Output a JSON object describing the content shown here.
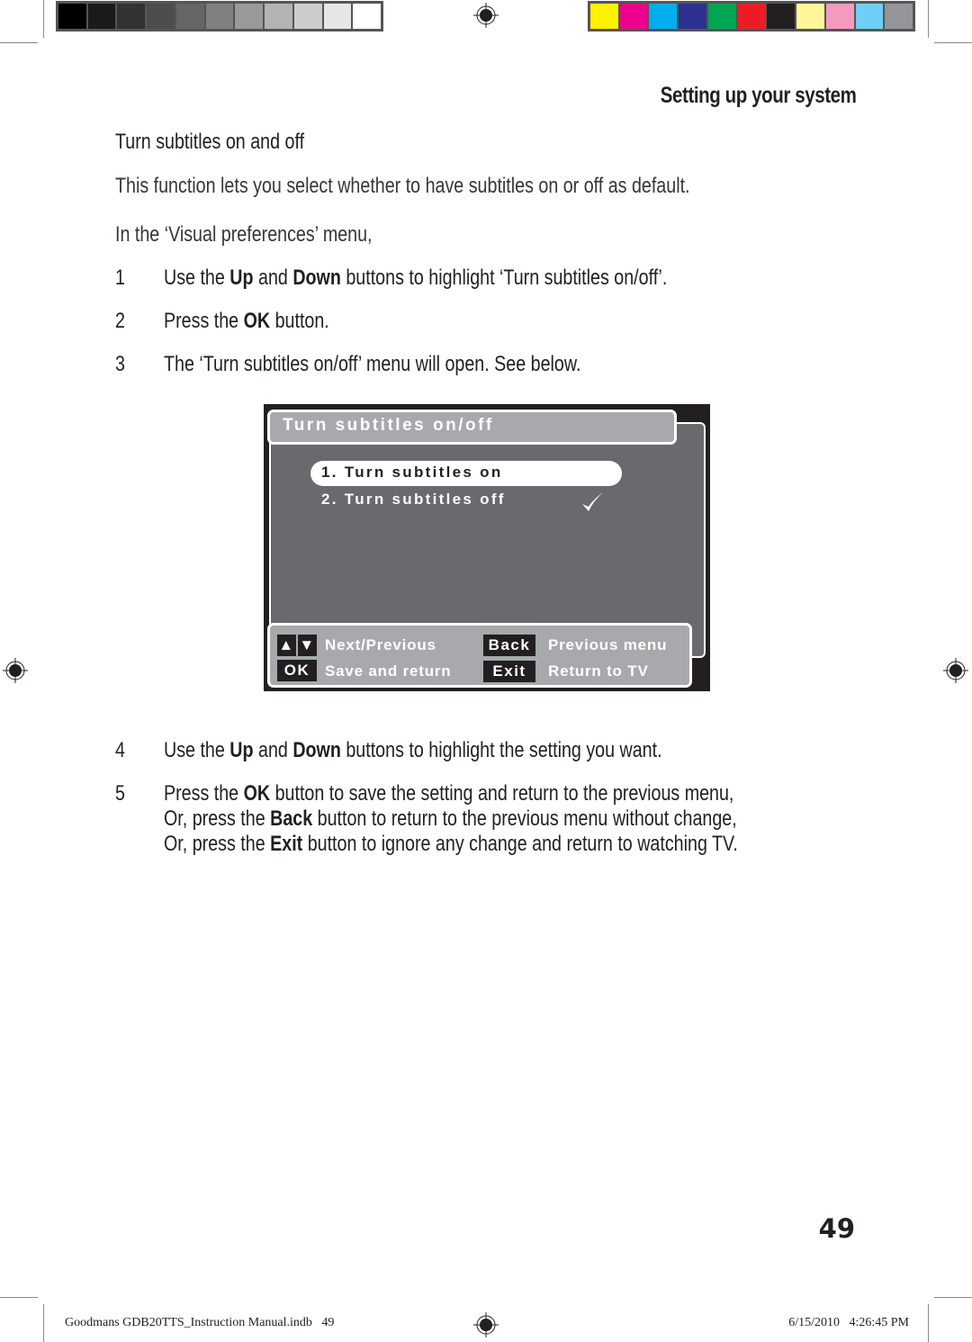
{
  "print_marks": {
    "gray_swatches": [
      "#000000",
      "#1a1a1a",
      "#333333",
      "#4d4d4d",
      "#666666",
      "#808080",
      "#999999",
      "#b3b3b3",
      "#cccccc",
      "#e6e6e6",
      "#ffffff"
    ],
    "color_swatches": [
      "#fff200",
      "#ec008c",
      "#00aeef",
      "#2e3192",
      "#00a651",
      "#ed1c24",
      "#231f20",
      "#fff799",
      "#f49ac1",
      "#6dcff6",
      "#939598"
    ]
  },
  "header": {
    "section": "Setting up your system"
  },
  "content": {
    "heading": "Turn subtitles on and off",
    "intro": "This function lets you select whether to have subtitles on or off as default.",
    "context": "In the ‘Visual preferences’ menu,",
    "steps": [
      {
        "num": "1",
        "parts": [
          "Use the ",
          "Up",
          " and ",
          "Down",
          " buttons to highlight ‘Turn subtitles on/off’."
        ]
      },
      {
        "num": "2",
        "parts": [
          "Press the ",
          "OK",
          " button."
        ]
      },
      {
        "num": "3",
        "parts": [
          "The ‘Turn subtitles on/off’ menu will open. See below."
        ]
      },
      {
        "num": "4",
        "parts": [
          "Use the ",
          "Up",
          " and ",
          "Down",
          " buttons to highlight the setting you want."
        ]
      },
      {
        "num": "5",
        "lines": [
          [
            "Press the ",
            "OK",
            " button to save the setting and return to the previous menu,"
          ],
          [
            "Or, press the ",
            "Back",
            " button to return to the previous menu without change,"
          ],
          [
            "Or, press the ",
            "Exit",
            " button to ignore any change and return to watching TV."
          ]
        ]
      }
    ]
  },
  "screen": {
    "title": "Turn subtitles on/off",
    "options": [
      {
        "label": "1. Turn subtitles on",
        "highlighted": true,
        "selected": false
      },
      {
        "label": "2. Turn subtitles off",
        "highlighted": false,
        "selected": true
      }
    ],
    "legend": {
      "nav_label": "Next/Previous",
      "ok_key": "OK",
      "ok_label": "Save and return",
      "back_key": "Back",
      "back_label": "Previous menu",
      "exit_key": "Exit",
      "exit_label": "Return to TV"
    },
    "colors": {
      "frame": "#231f20",
      "panel": "#6a6a6e",
      "title_bar": "#a7a9ac"
    }
  },
  "page_number": "49",
  "footer": {
    "file": "Goodmans GDB20TTS_Instruction Manual.indb   49",
    "timestamp": "6/15/2010   4:26:45 PM"
  }
}
